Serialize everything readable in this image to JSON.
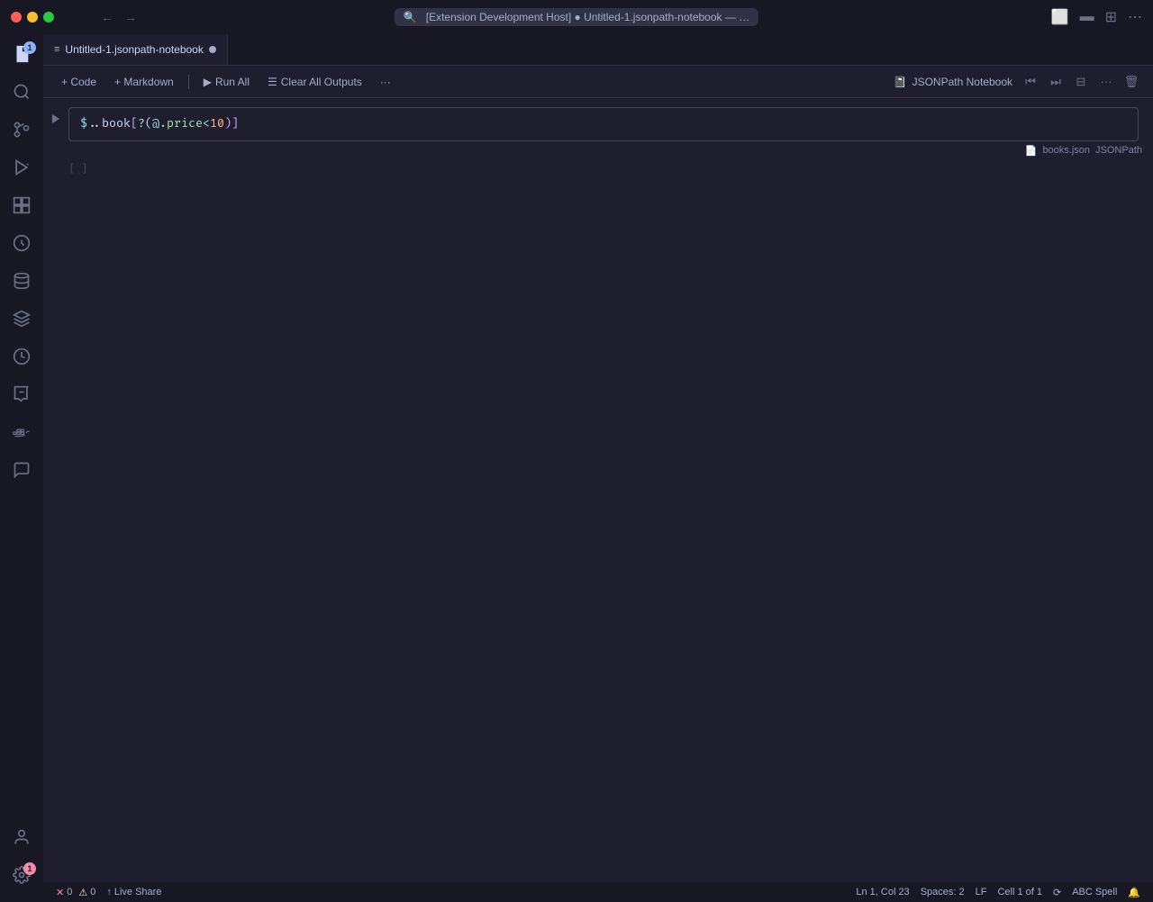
{
  "titlebar": {
    "traffic": {
      "close": "close",
      "minimize": "minimize",
      "maximize": "maximize"
    },
    "search_text": "[Extension Development Host] ● Untitled-1.jsonpath-notebook — …",
    "nav_back": "←",
    "nav_forward": "→"
  },
  "activity_bar": {
    "items": [
      {
        "id": "explorer",
        "icon": "📄",
        "badge": "1",
        "has_badge": true
      },
      {
        "id": "search",
        "icon": "🔍",
        "has_badge": false
      },
      {
        "id": "source-control",
        "icon": "⑂",
        "has_badge": false
      },
      {
        "id": "run-debug",
        "icon": "▷",
        "has_badge": false
      },
      {
        "id": "extensions",
        "icon": "⊞",
        "has_badge": false
      },
      {
        "id": "database",
        "icon": "🗄",
        "has_badge": false
      },
      {
        "id": "layers",
        "icon": "≡",
        "has_badge": false
      },
      {
        "id": "history",
        "icon": "⏱",
        "has_badge": false
      },
      {
        "id": "git-lens",
        "icon": "↺",
        "has_badge": false
      },
      {
        "id": "docker",
        "icon": "🐳",
        "has_badge": false
      },
      {
        "id": "chat",
        "icon": "💬",
        "has_badge": false
      }
    ],
    "bottom_items": [
      {
        "id": "account",
        "icon": "👤"
      },
      {
        "id": "settings",
        "icon": "⚙",
        "badge": "1",
        "has_badge": true
      }
    ]
  },
  "tab_bar": {
    "tabs": [
      {
        "label": "Untitled-1.jsonpath-notebook",
        "icon": "≡",
        "modified": true
      }
    ]
  },
  "notebook_toolbar": {
    "add_code_label": "+ Code",
    "add_markdown_label": "+ Markdown",
    "run_all_label": "Run All",
    "clear_outputs_label": "Clear All Outputs",
    "more_label": "···",
    "kernel_name": "JSONPath Notebook",
    "cell_actions": {
      "run_above": "⏮",
      "run_below": "⏭",
      "split": "⊟",
      "more": "···",
      "delete": "🗑"
    }
  },
  "cell": {
    "code": "$..book[?(@.price<10)]",
    "code_parts": {
      "dollar": "$",
      "path": "..book",
      "bracket_open": "[",
      "filter": "?(",
      "at": "@",
      "key": ".price",
      "op": "<",
      "num": "10",
      "bracket_close": ")]"
    },
    "kernel_file": "books.json",
    "kernel_lang": "JSONPath",
    "output_collapsed": true,
    "output_indicator": "[ ]"
  },
  "status_bar": {
    "errors": "0",
    "warnings": "0",
    "live_share": "Live Share",
    "position": "Ln 1, Col 23",
    "spaces": "Spaces: 2",
    "encoding": "LF",
    "cell_info": "Cell 1 of 1",
    "sync_icon": "sync",
    "spell": "Spell",
    "notification_icon": "🔔"
  }
}
